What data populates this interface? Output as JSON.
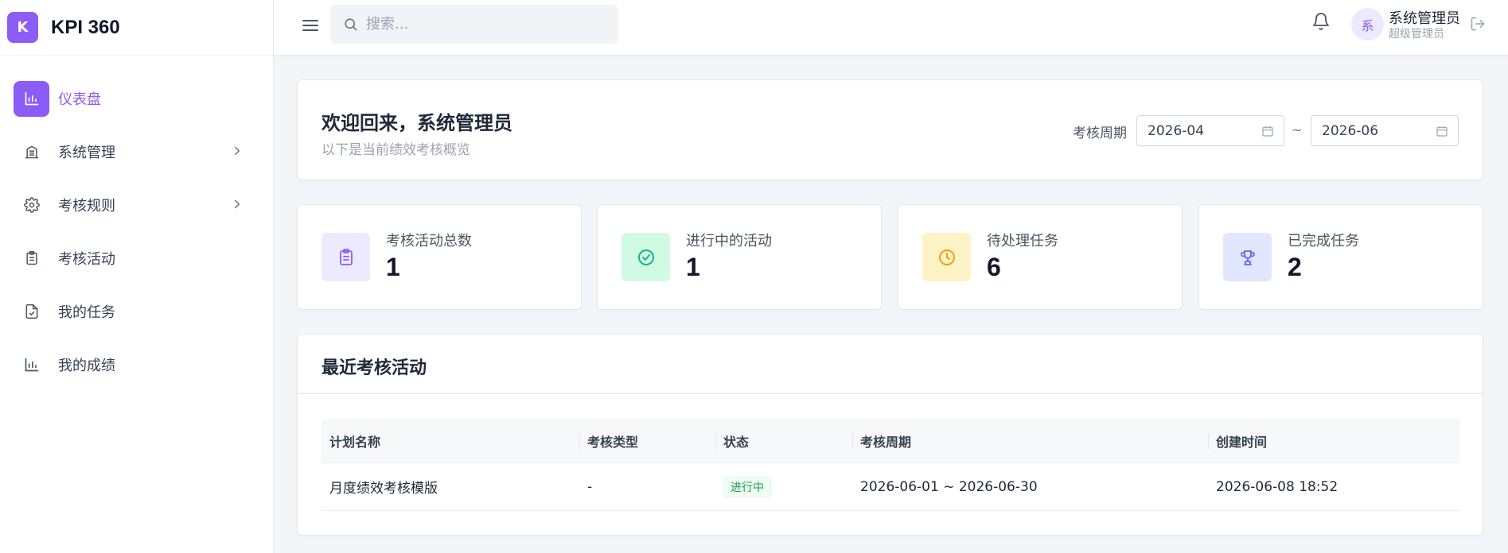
{
  "brand": {
    "logo_letter": "K",
    "name": "KPI 360",
    "color": "#8b5cf6"
  },
  "sidebar": {
    "items": [
      {
        "label": "仪表盘",
        "icon": "bar-chart-icon",
        "active": true
      },
      {
        "label": "系统管理",
        "icon": "building-icon",
        "has_children": true
      },
      {
        "label": "考核规则",
        "icon": "gear-icon",
        "has_children": true
      },
      {
        "label": "考核活动",
        "icon": "clipboard-list-icon"
      },
      {
        "label": "我的任务",
        "icon": "file-check-icon"
      },
      {
        "label": "我的成绩",
        "icon": "bar-chart-icon"
      }
    ]
  },
  "topbar": {
    "search_placeholder": "搜索...",
    "user": {
      "avatar_text": "系",
      "name": "系统管理员",
      "role": "超级管理员"
    }
  },
  "welcome": {
    "title": "欢迎回来，系统管理员",
    "subtitle": "以下是当前绩效考核概览",
    "period_label": "考核周期",
    "date_from": "2026-04",
    "separator": "~",
    "date_to": "2026-06"
  },
  "stats": [
    {
      "label": "考核活动总数",
      "value": "1",
      "icon": "clipboard-list-icon",
      "bg": "#ede9fe",
      "fg": "#8b5cf6"
    },
    {
      "label": "进行中的活动",
      "value": "1",
      "icon": "check-circle-icon",
      "bg": "#d1fae5",
      "fg": "#10b981"
    },
    {
      "label": "待处理任务",
      "value": "6",
      "icon": "clock-icon",
      "bg": "#fef3c7",
      "fg": "#f59e0b"
    },
    {
      "label": "已完成任务",
      "value": "2",
      "icon": "trophy-icon",
      "bg": "#e0e7ff",
      "fg": "#6366f1"
    }
  ],
  "recent": {
    "title": "最近考核活动",
    "columns": [
      "计划名称",
      "考核类型",
      "状态",
      "考核周期",
      "创建时间"
    ],
    "rows": [
      {
        "name": "月度绩效考核模版",
        "type": "-",
        "status": "进行中",
        "period": "2026-06-01 ~ 2026-06-30",
        "created": "2026-06-08 18:52"
      }
    ]
  }
}
